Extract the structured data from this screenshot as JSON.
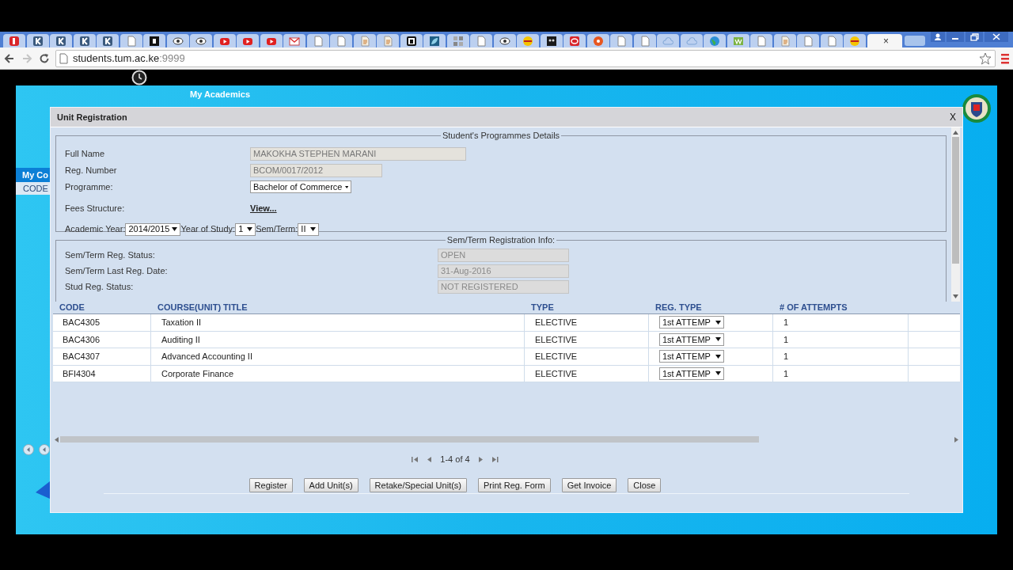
{
  "browser": {
    "tabs": [
      {
        "kind": "red",
        "selected": false
      },
      {
        "kind": "k",
        "selected": false
      },
      {
        "kind": "k",
        "selected": false
      },
      {
        "kind": "k",
        "selected": false
      },
      {
        "kind": "k",
        "selected": false
      },
      {
        "kind": "page",
        "selected": false
      },
      {
        "kind": "e",
        "selected": false
      },
      {
        "kind": "eye",
        "selected": false
      },
      {
        "kind": "eye",
        "selected": false
      },
      {
        "kind": "yt",
        "selected": false
      },
      {
        "kind": "yt",
        "selected": false
      },
      {
        "kind": "yt",
        "selected": false
      },
      {
        "kind": "mail",
        "selected": false
      },
      {
        "kind": "page",
        "selected": false
      },
      {
        "kind": "page",
        "selected": false
      },
      {
        "kind": "feed",
        "selected": false
      },
      {
        "kind": "feed",
        "selected": false
      },
      {
        "kind": "a",
        "selected": false
      },
      {
        "kind": "leaf",
        "selected": false
      },
      {
        "kind": "grid",
        "selected": false
      },
      {
        "kind": "page",
        "selected": false
      },
      {
        "kind": "eye",
        "selected": false
      },
      {
        "kind": "dash",
        "selected": false
      },
      {
        "kind": "owl",
        "selected": false
      },
      {
        "kind": "oracle",
        "selected": false
      },
      {
        "kind": "ask",
        "selected": false
      },
      {
        "kind": "page",
        "selected": false
      },
      {
        "kind": "page",
        "selected": false
      },
      {
        "kind": "cloud",
        "selected": false
      },
      {
        "kind": "cloud",
        "selected": false
      },
      {
        "kind": "globe",
        "selected": false
      },
      {
        "kind": "w3",
        "selected": false
      },
      {
        "kind": "page",
        "selected": false
      },
      {
        "kind": "feed",
        "selected": false
      },
      {
        "kind": "page",
        "selected": false
      },
      {
        "kind": "page",
        "selected": false
      },
      {
        "kind": "dash",
        "selected": false
      },
      {
        "kind": "blank",
        "selected": true,
        "close": "×"
      }
    ],
    "address": {
      "host": "students.tum.ac.ke",
      "port": ":9999"
    },
    "forward_disabled": true
  },
  "app": {
    "menu_title": "My Academics",
    "panel_title": "My Co",
    "panel_column": "CODE"
  },
  "dialog": {
    "title": "Unit Registration",
    "close": "X",
    "details": {
      "legend": "Student's Programmes Details",
      "fields": [
        {
          "label": "Full Name",
          "kind": "readonly",
          "value": "MAKOKHA STEPHEN MARANI"
        },
        {
          "label": "Reg. Number",
          "kind": "readonly",
          "value": "BCOM/0017/2012"
        },
        {
          "label": "Programme:",
          "kind": "select",
          "value": "Bachelor of Commerce"
        },
        {
          "label": "Fees Structure:",
          "kind": "link",
          "value": "View..."
        }
      ],
      "period": [
        {
          "label": "Academic Year:",
          "value": "2014/2015"
        },
        {
          "label": "Year of Study:",
          "value": "1"
        },
        {
          "label": "Sem/Term:",
          "value": "II"
        }
      ]
    },
    "registration": {
      "legend": "Sem/Term Registration Info:",
      "fields": [
        {
          "label": "Sem/Term Reg. Status:",
          "value": "OPEN"
        },
        {
          "label": "Sem/Term Last Reg. Date:",
          "value": "31-Aug-2016"
        },
        {
          "label": "Stud Reg. Status:",
          "value": "NOT REGISTERED"
        }
      ]
    },
    "table": {
      "columns": [
        "CODE",
        "COURSE(UNIT) TITLE",
        "TYPE",
        "REG. TYPE",
        "# OF ATTEMPTS"
      ],
      "rows": [
        {
          "code": "BAC4305",
          "title": "Taxation II",
          "type": "ELECTIVE",
          "reg_type": "1st ATTEMP",
          "attempts": "1"
        },
        {
          "code": "BAC4306",
          "title": "Auditing II",
          "type": "ELECTIVE",
          "reg_type": "1st ATTEMP",
          "attempts": "1"
        },
        {
          "code": "BAC4307",
          "title": "Advanced Accounting II",
          "type": "ELECTIVE",
          "reg_type": "1st ATTEMP",
          "attempts": "1"
        },
        {
          "code": "BFI4304",
          "title": "Corporate Finance",
          "type": "ELECTIVE",
          "reg_type": "1st ATTEMP",
          "attempts": "1"
        }
      ]
    },
    "pager": "1-4 of 4",
    "buttons": [
      "Register",
      "Add Unit(s)",
      "Retake/Special Unit(s)",
      "Print Reg. Form",
      "Get Invoice",
      "Close"
    ]
  }
}
